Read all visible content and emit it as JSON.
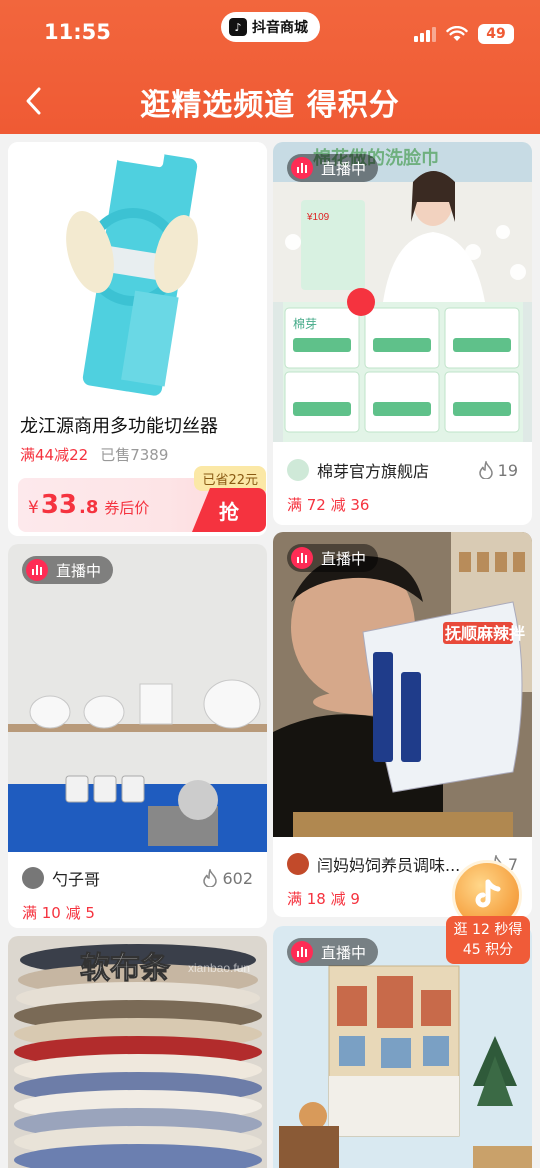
{
  "status_bar": {
    "time": "11:55",
    "app_name": "抖音商城",
    "battery": "49"
  },
  "header": {
    "title": "逛精选频道 得积分"
  },
  "colors": {
    "header_bg": "#ef5a34",
    "promo_red": "#f5333f",
    "live_pink": "#fe2c55"
  },
  "cards": {
    "product": {
      "title": "龙江源商用多功能切丝器",
      "promo": "满44减22",
      "sold": "已售7389",
      "currency": "¥",
      "price_int": "33",
      "price_dec": ".8",
      "price_note": "券后价",
      "saved": "已省22元",
      "buy_label": "抢"
    },
    "live1": {
      "badge": "直播中",
      "shop": "棉芽官方旗舰店",
      "heat": "19",
      "promo": "满 72 减 36",
      "img_text_top": "棉花做的洗脸巾",
      "img_text_brand": "棉芽",
      "img_text_price": "¥109"
    },
    "live2": {
      "shop": "勺子哥",
      "heat": "602",
      "promo": "满 10 减 5"
    },
    "live3": {
      "badge": "直播中",
      "shop": "闫妈妈饲养员调味...",
      "heat": "7",
      "promo": "满 18 减 9",
      "img_text": "抚顺麻辣拌"
    },
    "bottom_left": {
      "img_text": "软布条",
      "watermark": "xianbao.fun"
    },
    "bottom_right": {
      "badge": "直播中"
    }
  },
  "float_reward": {
    "line1": "逛 12 秒得",
    "line2": "45 积分"
  }
}
